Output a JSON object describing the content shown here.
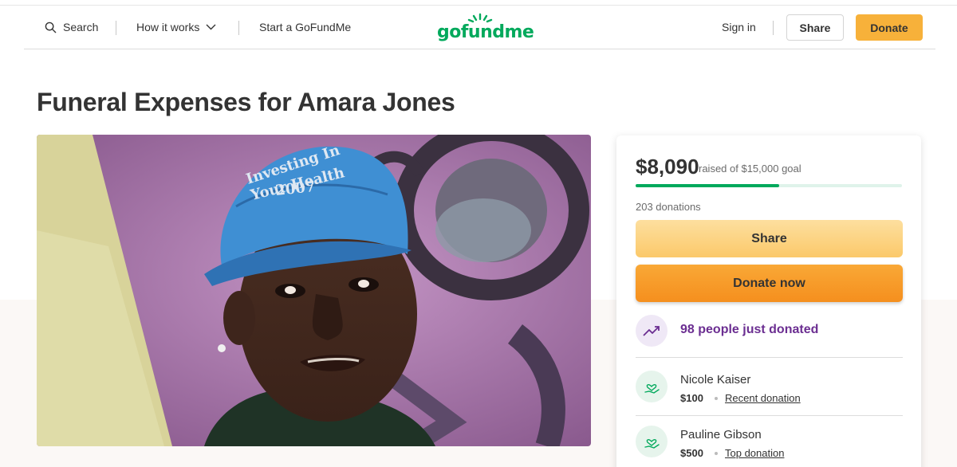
{
  "header": {
    "search_label": "Search",
    "how_it_works_label": "How it works",
    "start_label": "Start a GoFundMe",
    "logo_text": "gofundme",
    "sign_in_label": "Sign in",
    "share_label": "Share",
    "donate_label": "Donate"
  },
  "campaign": {
    "title": "Funeral Expenses for Amara Jones",
    "photo_cap_text": [
      "Investing In",
      "Your Health",
      "2007"
    ]
  },
  "card": {
    "raised": "$8,090",
    "goal_text": "raised of $15,000 goal",
    "progress_fraction": 0.539,
    "donations_count": "203 donations",
    "share_label": "Share",
    "donate_now_label": "Donate now",
    "trend_text": "98 people just donated",
    "donors": [
      {
        "name": "Nicole Kaiser",
        "amount": "$100",
        "tag": "Recent donation"
      },
      {
        "name": "Pauline Gibson",
        "amount": "$500",
        "tag": "Top donation"
      }
    ]
  },
  "colors": {
    "brand_green": "#02a95c",
    "donate_orange": "#f7b13a",
    "trend_purple": "#6b2e91"
  },
  "icons": [
    "search-icon",
    "chevron-down-icon",
    "logo-sun-icon",
    "trend-up-icon",
    "donor-heart-hand-icon"
  ]
}
